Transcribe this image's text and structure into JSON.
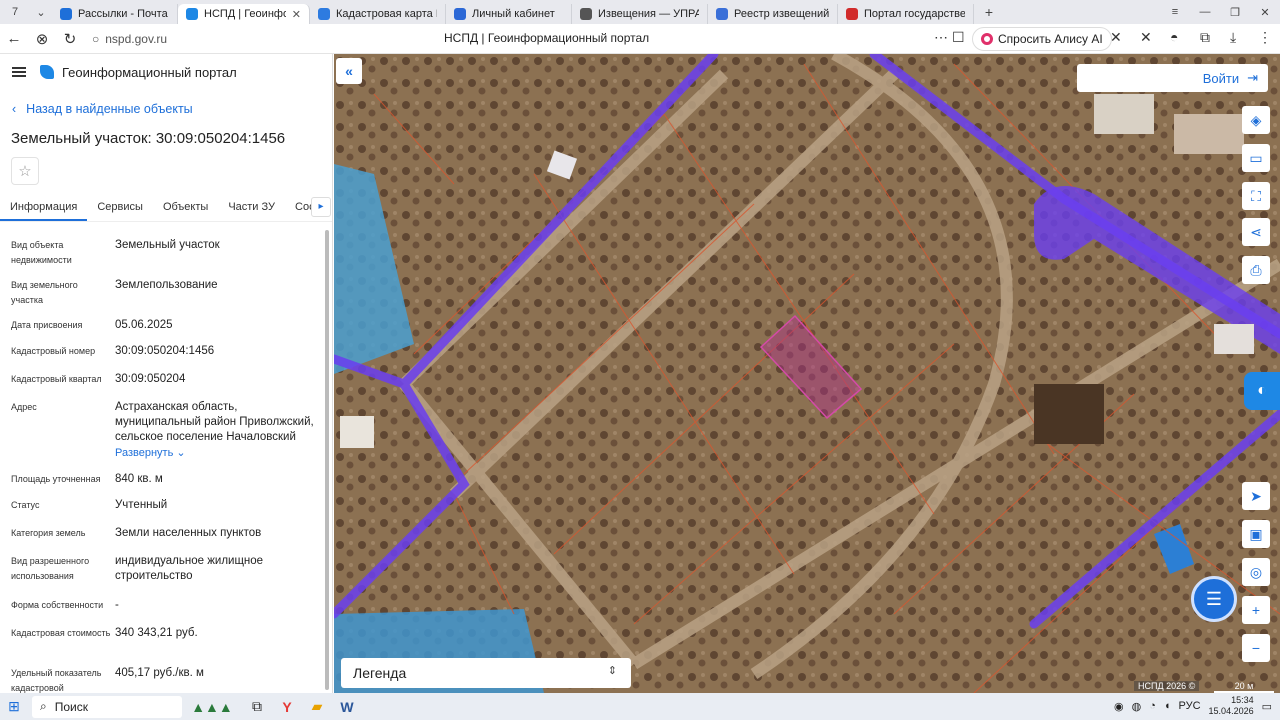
{
  "browser": {
    "tab_count": "7",
    "tabs": [
      {
        "label": "Рассылки - Почта Mail",
        "color": "#1e6fd9"
      },
      {
        "label": "НСПД | Геоинформаци",
        "color": "#1e88e5",
        "active": true
      },
      {
        "label": "Кадастровая карта Росси",
        "color": "#2d7be0"
      },
      {
        "label": "Личный кабинет",
        "color": "#2c68d6"
      },
      {
        "label": "Извещения — УПРАВЛЕН",
        "color": "#555555"
      },
      {
        "label": "Реестр извещений",
        "color": "#3a6fd8"
      },
      {
        "label": "Портал государственно",
        "color": "#d12b2b"
      }
    ],
    "url": "nspd.gov.ru",
    "page_title": "НСПД | Геоинформационный портал",
    "alice_label": "Спросить Алису AI"
  },
  "sidebar": {
    "portal_title": "Геоинформационный портал",
    "back_label": "Назад в найденные объекты",
    "object_title": "Земельный участок: 30:09:050204:1456",
    "tabs": [
      "Информация",
      "Сервисы",
      "Объекты",
      "Части ЗУ",
      "Состав"
    ],
    "rows": [
      {
        "k": "Вид объекта недвижимости",
        "v": "Земельный участок"
      },
      {
        "k": "Вид земельного участка",
        "v": "Землепользование"
      },
      {
        "k": "Дата присвоения",
        "v": "05.06.2025"
      },
      {
        "k": "Кадастровый номер",
        "v": "30:09:050204:1456"
      },
      {
        "k": "Кадастровый квартал",
        "v": "30:09:050204"
      },
      {
        "k": "Адрес",
        "v": "Астраханская область, муниципальный район Приволжский, сельское поселение Началовский"
      },
      {
        "k": "Площадь уточненная",
        "v": "840 кв. м"
      },
      {
        "k": "Статус",
        "v": "Учтенный"
      },
      {
        "k": "Категория земель",
        "v": "Земли населенных пунктов"
      },
      {
        "k": "Вид разрешенного использования",
        "v": "индивидуальное жилищное строительство"
      },
      {
        "k": "Форма собственности",
        "v": "-"
      },
      {
        "k": "Кадастровая стоимость",
        "v": "340 343,21 руб."
      },
      {
        "k": "Удельный показатель кадастровой",
        "v": "405,17 руб./кв. м"
      }
    ],
    "expand_label": "Развернуть"
  },
  "map": {
    "login_label": "Войти",
    "legend_label": "Легенда",
    "attribution": "НСПД 2026 ©",
    "scale_label": "20 м"
  },
  "taskbar": {
    "search_label": "Поиск",
    "lang": "РУС",
    "time": "15:34",
    "date": "15.04.2026"
  }
}
